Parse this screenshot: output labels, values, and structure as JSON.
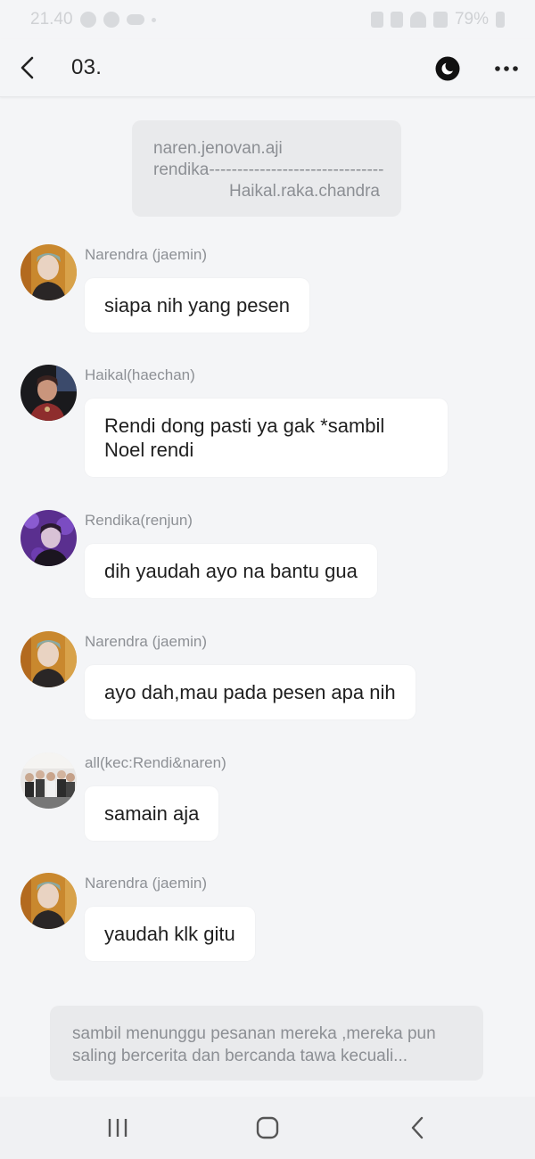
{
  "status_bar": {
    "time": "21.40",
    "battery": "79%"
  },
  "header": {
    "title": "03.",
    "back_icon": "chevron-left-icon",
    "theme_icon": "moon-icon",
    "more_icon": "more-horizontal-icon"
  },
  "intro": {
    "line1": "naren.jenovan.aji",
    "line2": "rendika-------------------------------",
    "line3": "Haikal.raka.chandra"
  },
  "messages": [
    {
      "sender": "Narendra (jaemin)",
      "text": "siapa nih yang pesen",
      "avatar": "avatar-jaemin"
    },
    {
      "sender": "Haikal(haechan)",
      "text": "Rendi dong pasti ya gak *sambil Noel rendi",
      "avatar": "avatar-haechan"
    },
    {
      "sender": "Rendika(renjun)",
      "text": "dih yaudah ayo na bantu gua",
      "avatar": "avatar-renjun"
    },
    {
      "sender": "Narendra (jaemin)",
      "text": "ayo dah,mau pada pesen apa nih",
      "avatar": "avatar-jaemin"
    },
    {
      "sender": "all(kec:Rendi&naren)",
      "text": "samain aja",
      "avatar": "avatar-group"
    },
    {
      "sender": "Narendra (jaemin)",
      "text": "yaudah klk gitu",
      "avatar": "avatar-jaemin"
    }
  ],
  "narration": {
    "text": "sambil menunggu pesanan mereka ,mereka pun saling bercerita dan bercanda tawa kecuali..."
  },
  "nav": {
    "recents_icon": "recent-apps-icon",
    "home_icon": "home-icon",
    "back_icon": "back-icon"
  },
  "colors": {
    "background": "#f4f5f7",
    "bubble": "#ffffff",
    "narration_bg": "#e9eaec",
    "sender_text": "#8d9095"
  }
}
